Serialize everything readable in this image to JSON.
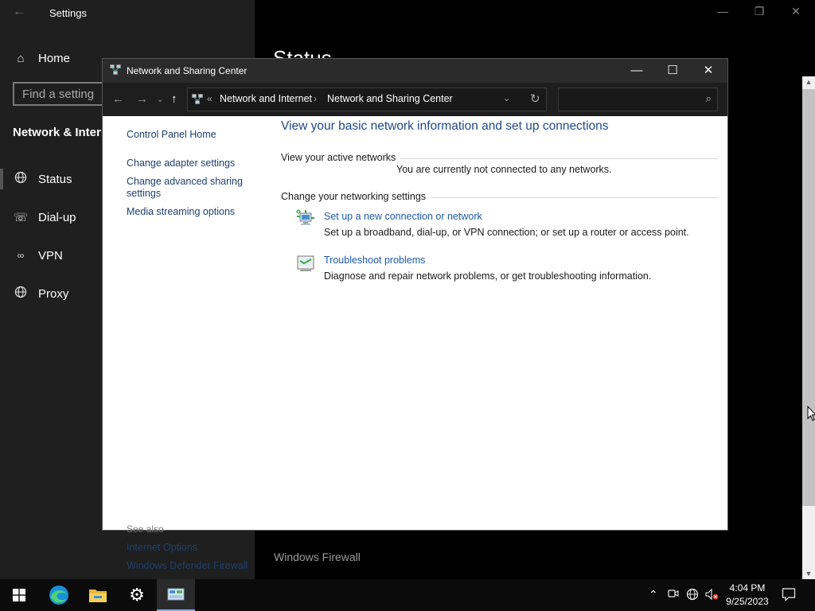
{
  "settings": {
    "title": "Settings",
    "home_label": "Home",
    "search_placeholder": "Find a setting",
    "section_title": "Network & Internet",
    "nav": [
      {
        "label": "Status",
        "icon": "globe-icon"
      },
      {
        "label": "Dial-up",
        "icon": "phone-icon"
      },
      {
        "label": "VPN",
        "icon": "vpn-icon"
      },
      {
        "label": "Proxy",
        "icon": "globe-icon"
      }
    ],
    "page_heading": "Status",
    "windows_firewall_label": "Windows Firewall"
  },
  "nsc": {
    "title": "Network and Sharing Center",
    "address": {
      "overflow": "«",
      "segments": [
        "Network and Internet",
        "Network and Sharing Center"
      ]
    },
    "search_value": "",
    "left_links": [
      "Control Panel Home",
      "Change adapter settings",
      "Change advanced sharing settings",
      "Media streaming options"
    ],
    "see_also_label": "See also",
    "see_also_links": [
      "Internet Options",
      "Windows Defender Firewall"
    ],
    "main_title": "View your basic network information and set up connections",
    "active_networks_label": "View your active networks",
    "not_connected_text": "You are currently not connected to any networks.",
    "change_settings_label": "Change your networking settings",
    "tasks": [
      {
        "link": "Set up a new connection or network",
        "desc": "Set up a broadband, dial-up, or VPN connection; or set up a router or access point.",
        "icon": "new-connection-icon"
      },
      {
        "link": "Troubleshoot problems",
        "desc": "Diagnose and repair network problems, or get troubleshooting information.",
        "icon": "troubleshoot-icon"
      }
    ]
  },
  "taskbar": {
    "time": "4:04 PM",
    "date": "9/25/2023",
    "apps": [
      "start-icon",
      "edge-icon",
      "file-explorer-icon",
      "settings-icon",
      "control-panel-icon"
    ]
  },
  "colors": {
    "link_blue": "#1e5aa8",
    "title_blue": "#1e4a8a",
    "dark_titlebar": "#2b2b2b"
  }
}
